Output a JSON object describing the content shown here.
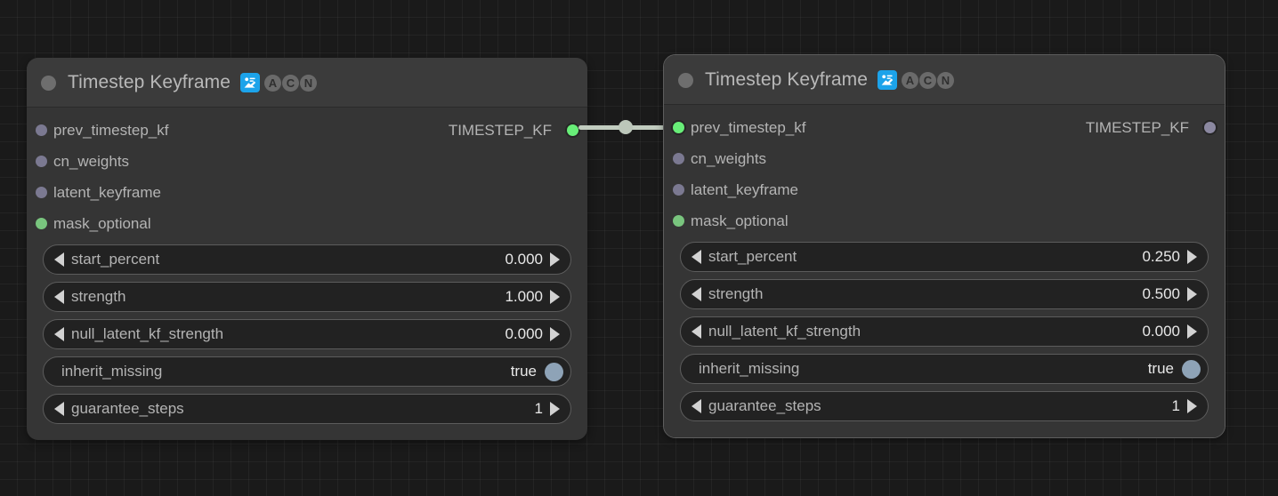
{
  "app": {
    "canvas_background": "#1a1a1a",
    "grid_color": "#232323"
  },
  "nodes": [
    {
      "id": "timestep-keyframe-left",
      "title": "Timestep Keyframe",
      "collapse_icon": "collapse-dot-icon",
      "badges": [
        {
          "name": "node-source-badge-icon",
          "label": "",
          "color": "#1ca3ea"
        },
        {
          "name": "badge-letter-a",
          "label": "A"
        },
        {
          "name": "badge-letter-c",
          "label": "C"
        },
        {
          "name": "badge-letter-n",
          "label": "N"
        }
      ],
      "inputs": [
        {
          "label": "prev_timestep_kf",
          "state": "unconnected",
          "color": "#7b7991"
        },
        {
          "label": "cn_weights",
          "state": "unconnected",
          "color": "#7b7991"
        },
        {
          "label": "latent_keyframe",
          "state": "unconnected",
          "color": "#7b7991"
        },
        {
          "label": "mask_optional",
          "state": "optional",
          "color": "#79c57e"
        }
      ],
      "outputs": [
        {
          "label": "TIMESTEP_KF",
          "state": "connected",
          "color": "#68ee78"
        }
      ],
      "widgets": [
        {
          "name": "start_percent",
          "value": "0.000",
          "type": "number"
        },
        {
          "name": "strength",
          "value": "1.000",
          "type": "number"
        },
        {
          "name": "null_latent_kf_strength",
          "value": "0.000",
          "type": "number"
        },
        {
          "name": "inherit_missing",
          "value": "true",
          "type": "toggle"
        },
        {
          "name": "guarantee_steps",
          "value": "1",
          "type": "number"
        }
      ]
    },
    {
      "id": "timestep-keyframe-right",
      "title": "Timestep Keyframe",
      "collapse_icon": "collapse-dot-icon",
      "badges": [
        {
          "name": "node-source-badge-icon",
          "label": "",
          "color": "#1ca3ea"
        },
        {
          "name": "badge-letter-a",
          "label": "A"
        },
        {
          "name": "badge-letter-c",
          "label": "C"
        },
        {
          "name": "badge-letter-n",
          "label": "N"
        }
      ],
      "inputs": [
        {
          "label": "prev_timestep_kf",
          "state": "connected",
          "color": "#68ee78"
        },
        {
          "label": "cn_weights",
          "state": "unconnected",
          "color": "#7b7991"
        },
        {
          "label": "latent_keyframe",
          "state": "unconnected",
          "color": "#7b7991"
        },
        {
          "label": "mask_optional",
          "state": "optional",
          "color": "#79c57e"
        }
      ],
      "outputs": [
        {
          "label": "TIMESTEP_KF",
          "state": "unconnected",
          "color": "#8b88a0"
        }
      ],
      "widgets": [
        {
          "name": "start_percent",
          "value": "0.250",
          "type": "number"
        },
        {
          "name": "strength",
          "value": "0.500",
          "type": "number"
        },
        {
          "name": "null_latent_kf_strength",
          "value": "0.000",
          "type": "number"
        },
        {
          "name": "inherit_missing",
          "value": "true",
          "type": "toggle"
        },
        {
          "name": "guarantee_steps",
          "value": "1",
          "type": "number"
        }
      ]
    }
  ],
  "link": {
    "name": "link-timestep-kf",
    "color": "#c2cdc0",
    "from": "timestep-keyframe-left.TIMESTEP_KF",
    "to": "timestep-keyframe-right.prev_timestep_kf"
  }
}
